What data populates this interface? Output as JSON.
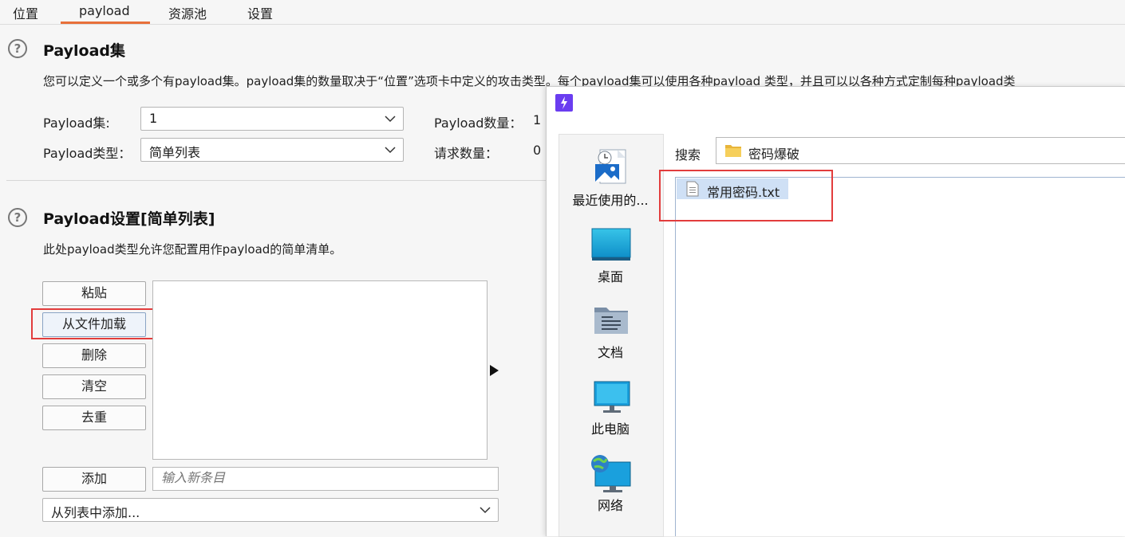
{
  "tabs": [
    {
      "label": "位置"
    },
    {
      "label": "payload"
    },
    {
      "label": "资源池"
    },
    {
      "label": "设置"
    }
  ],
  "payload_sets": {
    "title": "Payload集",
    "description": "您可以定义一个或多个有payload集。payload集的数量取决于“位置”选项卡中定义的攻击类型。每个payload集可以使用各种payload 类型，并且可以以各种方式定制每种payload类",
    "set_label": "Payload集:",
    "set_value": "1",
    "type_label": "Payload类型：",
    "type_value": "简单列表",
    "payload_count_label": "Payload数量：",
    "payload_count_value": "1",
    "request_count_label": "请求数量：",
    "request_count_value": "0"
  },
  "payload_settings": {
    "title": "Payload设置[简单列表]",
    "description": "此处payload类型允许您配置用作payload的简单清单。",
    "buttons": {
      "paste": "粘贴",
      "load": "从文件加载",
      "remove": "删除",
      "clear": "清空",
      "dedupe": "去重",
      "add": "添加"
    },
    "new_item_placeholder": "输入新条目",
    "add_from_list": "从列表中添加..."
  },
  "dialog": {
    "search_label": "搜索",
    "folder_name": "密码爆破",
    "places": [
      {
        "label": "最近使用的...",
        "icon": "recent-icon"
      },
      {
        "label": "桌面",
        "icon": "desktop-icon"
      },
      {
        "label": "文档",
        "icon": "documents-icon"
      },
      {
        "label": "此电脑",
        "icon": "computer-icon"
      },
      {
        "label": "网络",
        "icon": "network-icon"
      }
    ],
    "files": [
      {
        "name": "常用密码.txt"
      }
    ]
  },
  "colors": {
    "accent": "#e8703a",
    "highlight": "#e23c3c",
    "selection": "#cfe0f5",
    "app_icon": "#6a3df0"
  }
}
